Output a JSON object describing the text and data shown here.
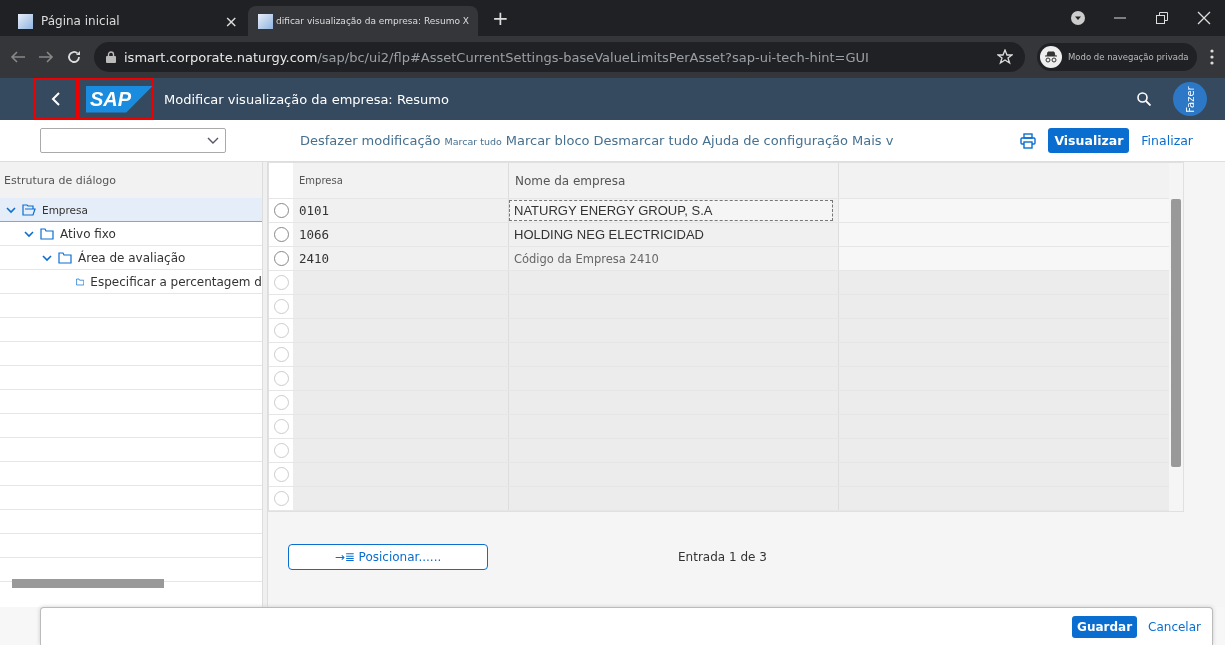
{
  "browser": {
    "tabs": [
      {
        "title": "Página inicial",
        "close": "×",
        "selected": false
      },
      {
        "title": "dificar visualização da empresa: Resumo X",
        "selected": true
      }
    ],
    "new_tab": "+",
    "url_host": "ismart.corporate.naturgy.com",
    "url_path": "/sap/bc/ui2/flp#AssetCurrentSettings-baseValueLimitsPerAsset?sap-ui-tech-hint=GUI",
    "profile_label": "Modo de navegação privada"
  },
  "shell": {
    "title": "Modificar visualização da empresa: Resumo",
    "logo": "SAP",
    "avatar": "Fazer"
  },
  "toolbar": {
    "actions": [
      {
        "label": "Desfazer modificação",
        "small": false
      },
      {
        "label": "Marcar tudo",
        "small": true
      },
      {
        "label": "Marcar bloco",
        "small": false
      },
      {
        "label": "Desmarcar tudo",
        "small": false
      },
      {
        "label": "Ajuda de configuração",
        "small": false
      },
      {
        "label": "Mais v",
        "small": false
      }
    ],
    "primary": "Visualizar",
    "secondary": "Finalizar"
  },
  "tree": {
    "title": "Estrutura de diálogo",
    "items": [
      {
        "label": "Empresa",
        "expanded": true,
        "selected": true,
        "children": [
          {
            "label": "Ativo fixo",
            "expanded": true,
            "selected": false,
            "children": [
              {
                "label": "Área de avaliação",
                "expanded": true,
                "selected": false,
                "children": [
                  {
                    "label": "Especificar a percentagem d",
                    "selected": false
                  }
                ]
              }
            ]
          }
        ]
      }
    ]
  },
  "table": {
    "columns": [
      "Empresa",
      "Nome da empresa"
    ],
    "rows": [
      {
        "code": "0101",
        "name": "NATURGY ENERGY GROUP, S.A",
        "selected": false,
        "focused": true,
        "dimmed": false
      },
      {
        "code": "1066",
        "name": "HOLDING NEG ELECTRICIDAD",
        "selected": false,
        "focused": false,
        "dimmed": false
      },
      {
        "code": "2410",
        "name": "Código da Empresa 2410",
        "selected": false,
        "focused": false,
        "dimmed": true
      }
    ],
    "empty_rows": [
      {
        "selected": false
      },
      {
        "selected": false
      },
      {
        "selected": false
      },
      {
        "selected": false
      },
      {
        "selected": false
      },
      {
        "selected": false
      },
      {
        "selected": false
      },
      {
        "selected": false
      },
      {
        "selected": false
      },
      {
        "selected": false
      }
    ]
  },
  "position_button": "→≣ Posicionar......",
  "entry": "Entrada 1 de 3",
  "footer": {
    "save": "Guardar",
    "cancel": "Cancelar"
  }
}
